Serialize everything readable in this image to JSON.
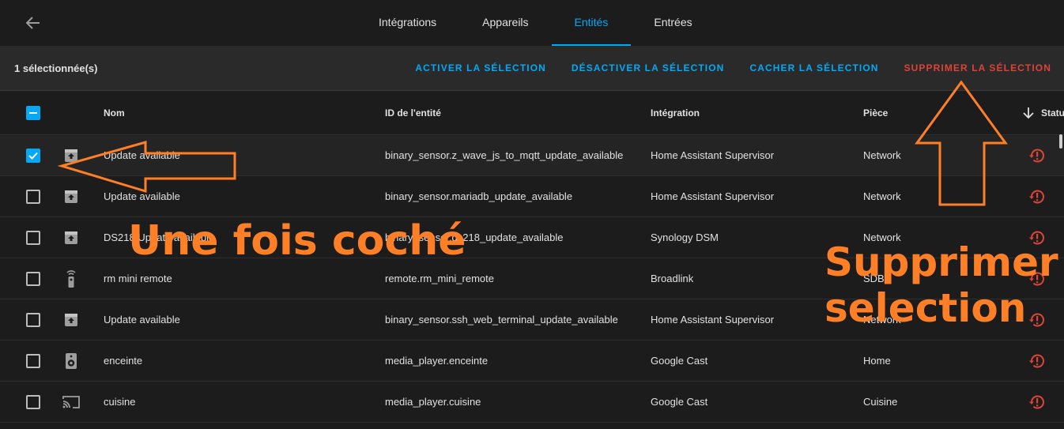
{
  "header": {
    "tabs": [
      {
        "label": "Intégrations",
        "active": false
      },
      {
        "label": "Appareils",
        "active": false
      },
      {
        "label": "Entités",
        "active": true
      },
      {
        "label": "Entrées",
        "active": false
      }
    ]
  },
  "selection_bar": {
    "count_label": "1 sélectionnée(s)",
    "actions": {
      "enable": "ACTIVER LA SÉLECTION",
      "disable": "DÉSACTIVER LA SÉLECTION",
      "hide": "CACHER LA SÉLECTION",
      "delete": "SUPPRIMER LA SÉLECTION"
    }
  },
  "table": {
    "columns": {
      "name": "Nom",
      "entity_id": "ID de l'entité",
      "integration": "Intégration",
      "room": "Pièce",
      "status": "Statu"
    },
    "sort_icon": "arrow-down-icon",
    "rows": [
      {
        "checked": true,
        "icon": "update-icon",
        "name": "Update available",
        "entity_id": "binary_sensor.z_wave_js_to_mqtt_update_available",
        "integration": "Home Assistant Supervisor",
        "room": "Network",
        "status_icon": "restore-alert-icon"
      },
      {
        "checked": false,
        "icon": "update-icon",
        "name": "Update available",
        "entity_id": "binary_sensor.mariadb_update_available",
        "integration": "Home Assistant Supervisor",
        "room": "Network",
        "status_icon": "restore-alert-icon"
      },
      {
        "checked": false,
        "icon": "update-icon",
        "name": "DS218 Update available",
        "entity_id": "binary_sensor.ds218_update_available",
        "integration": "Synology DSM",
        "room": "Network",
        "status_icon": "restore-alert-icon"
      },
      {
        "checked": false,
        "icon": "remote-icon",
        "name": "rm mini remote",
        "entity_id": "remote.rm_mini_remote",
        "integration": "Broadlink",
        "room": "SDB",
        "status_icon": "restore-alert-icon"
      },
      {
        "checked": false,
        "icon": "update-icon",
        "name": "Update available",
        "entity_id": "binary_sensor.ssh_web_terminal_update_available",
        "integration": "Home Assistant Supervisor",
        "room": "Network",
        "status_icon": "restore-alert-icon"
      },
      {
        "checked": false,
        "icon": "speaker-icon",
        "name": "enceinte",
        "entity_id": "media_player.enceinte",
        "integration": "Google Cast",
        "room": "Home",
        "status_icon": "restore-alert-icon"
      },
      {
        "checked": false,
        "icon": "cast-icon",
        "name": "cuisine",
        "entity_id": "media_player.cuisine",
        "integration": "Google Cast",
        "room": "Cuisine",
        "status_icon": "restore-alert-icon"
      }
    ]
  },
  "annotations": {
    "checked_note": "Une fois coché",
    "delete_note_line1": "Supprimer",
    "delete_note_line2": "selection"
  },
  "colors": {
    "accent": "#03a9f4",
    "danger": "#db4437",
    "annotation": "#ff7f27",
    "background": "#1c1c1c",
    "selection_bar": "#2a2a2a"
  }
}
